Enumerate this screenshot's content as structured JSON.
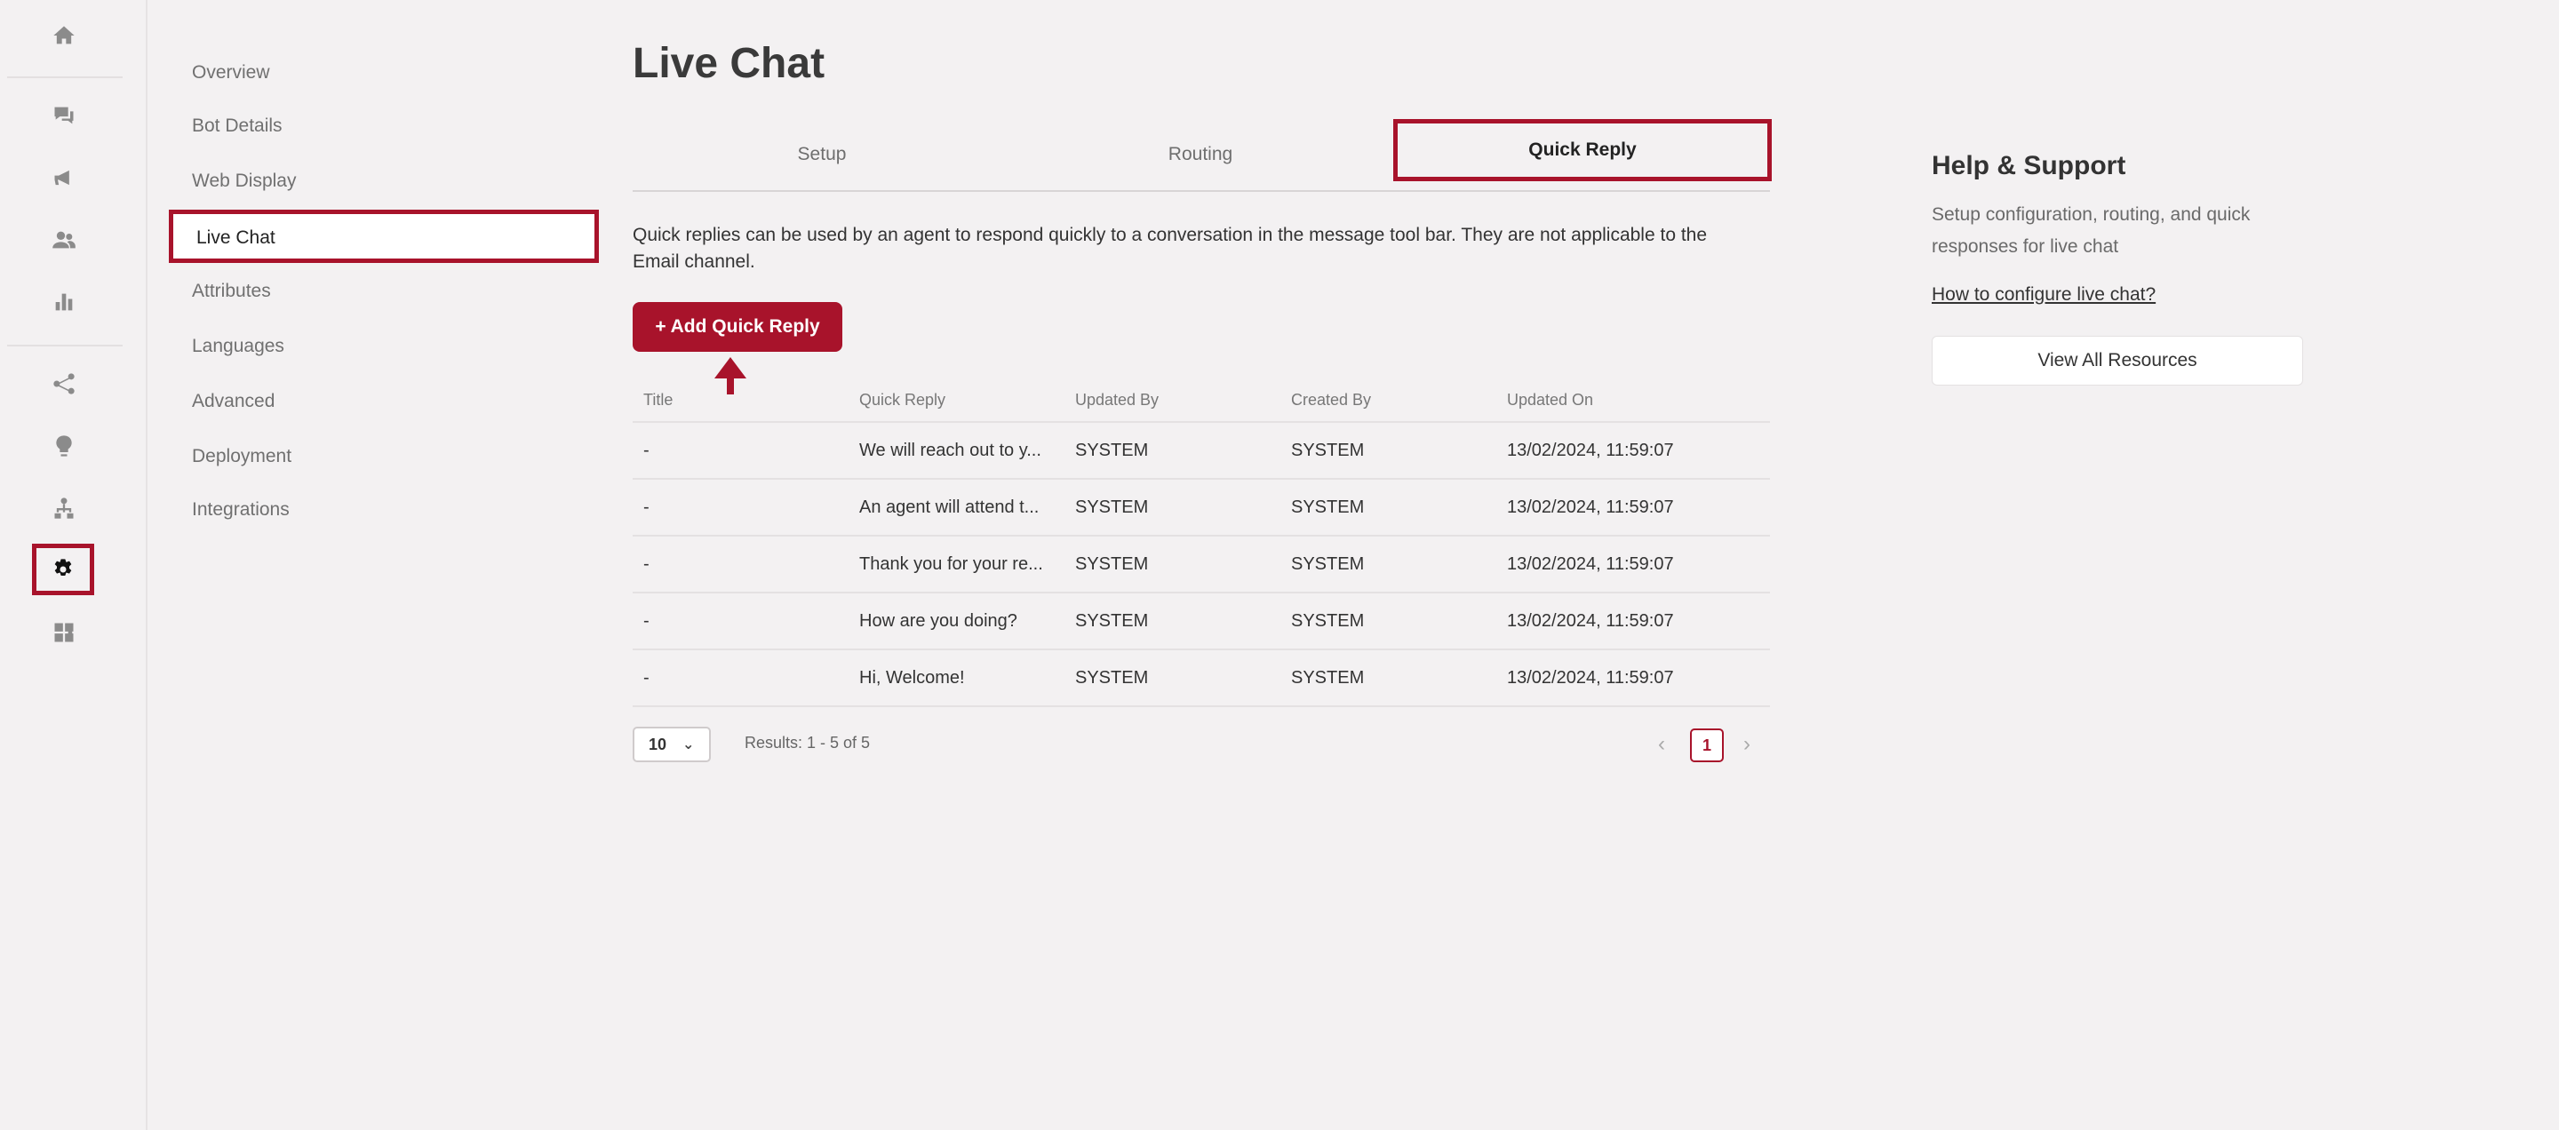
{
  "rail": {
    "items": [
      {
        "name": "home-icon"
      },
      {
        "name": "chat-icon"
      },
      {
        "name": "megaphone-icon"
      },
      {
        "name": "users-icon"
      },
      {
        "name": "bar-chart-icon"
      },
      {
        "name": "flow-icon"
      },
      {
        "name": "lightbulb-icon"
      },
      {
        "name": "hierarchy-icon"
      },
      {
        "name": "gear-icon",
        "active": true
      },
      {
        "name": "puzzle-icon"
      }
    ]
  },
  "menu": {
    "items": [
      "Overview",
      "Bot Details",
      "Web Display",
      "Live Chat",
      "Attributes",
      "Languages",
      "Advanced",
      "Deployment",
      "Integrations"
    ],
    "active": "Live Chat"
  },
  "page": {
    "title": "Live Chat",
    "tabs": [
      "Setup",
      "Routing",
      "Quick Reply"
    ],
    "active_tab": "Quick Reply",
    "intro": "Quick replies can be used by an agent to respond quickly to a conversation in the message tool bar. They are not applicable to the Email channel.",
    "add_button": "+ Add Quick Reply"
  },
  "table": {
    "columns": [
      "Title",
      "Quick Reply",
      "Updated By",
      "Created By",
      "Updated On"
    ],
    "rows": [
      [
        "-",
        "We will reach out to y...",
        "SYSTEM",
        "SYSTEM",
        "13/02/2024, 11:59:07"
      ],
      [
        "-",
        "An agent will attend t...",
        "SYSTEM",
        "SYSTEM",
        "13/02/2024, 11:59:07"
      ],
      [
        "-",
        "Thank you for your re...",
        "SYSTEM",
        "SYSTEM",
        "13/02/2024, 11:59:07"
      ],
      [
        "-",
        "How are you doing?",
        "SYSTEM",
        "SYSTEM",
        "13/02/2024, 11:59:07"
      ],
      [
        "-",
        "Hi, Welcome!",
        "SYSTEM",
        "SYSTEM",
        "13/02/2024, 11:59:07"
      ]
    ]
  },
  "pagination": {
    "page_size": "10",
    "results": "Results: 1 - 5 of 5",
    "current_page": "1",
    "prev": "‹",
    "next": "›"
  },
  "help": {
    "title": "Help & Support",
    "description": "Setup configuration, routing, and quick responses for live chat",
    "link": "How to configure live chat?",
    "button": "View All Resources"
  },
  "colors": {
    "accent": "#a8132b",
    "background": "#f3f1f2"
  }
}
